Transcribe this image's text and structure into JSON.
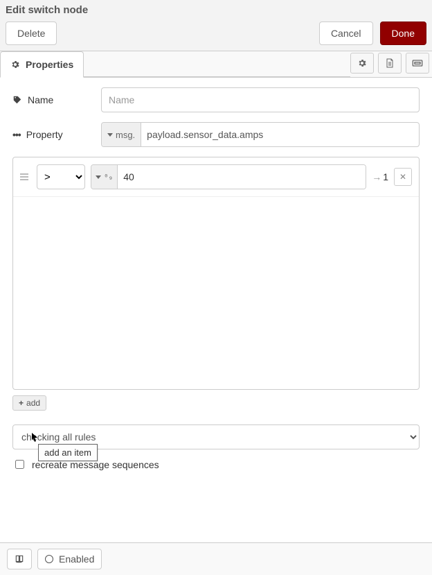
{
  "title": "Edit switch node",
  "buttons": {
    "delete": "Delete",
    "cancel": "Cancel",
    "done": "Done"
  },
  "tabs": {
    "properties": "Properties"
  },
  "form": {
    "name_label": "Name",
    "name_placeholder": "Name",
    "name_value": "",
    "property_label": "Property",
    "property_prefix": "msg.",
    "property_value": "payload.sensor_data.amps"
  },
  "rules": [
    {
      "operator": ">",
      "type_icon": "⁰₉",
      "value": "40",
      "output_arrow": "→",
      "output_index": "1"
    }
  ],
  "add_label": "add",
  "add_tooltip": "add an item",
  "mode": {
    "selected": "checking all rules"
  },
  "recreate_label": "recreate message sequences",
  "recreate_checked": false,
  "footer": {
    "enabled": "Enabled"
  }
}
